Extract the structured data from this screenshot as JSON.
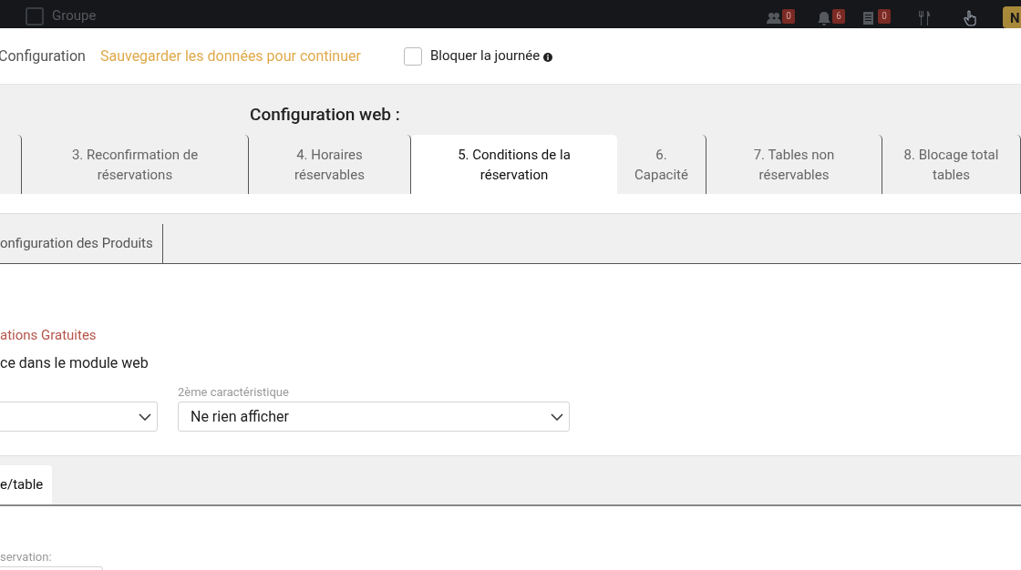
{
  "top_bar": {
    "group_checkbox": {
      "checked": false
    },
    "group_label": "Groupe",
    "badges": [
      {
        "kind": "people",
        "count": "0"
      },
      {
        "kind": "bell",
        "count": "6"
      },
      {
        "kind": "list",
        "count": "0"
      },
      {
        "kind": "cutlery"
      },
      {
        "kind": "hand"
      }
    ],
    "button": "N"
  },
  "header": {
    "title": "Configuration",
    "save_notice": "Sauvegarder les données pour continuer",
    "block_day": {
      "label": "Bloquer la journée",
      "checked": false
    }
  },
  "web_config": {
    "title": "Configuration web :",
    "tabs": [
      {
        "selected": false
      },
      {
        "lines": [
          "3. Reconfirmation de",
          "réservations"
        ],
        "selected": false
      },
      {
        "lines": [
          "4. Horaires",
          "réservables"
        ],
        "selected": false
      },
      {
        "lines": [
          "5. Conditions de la",
          "réservation"
        ],
        "selected": true
      },
      {
        "lines": [
          "6.",
          "Capacité"
        ],
        "selected": false
      },
      {
        "lines": [
          "7. Tables non",
          "réservables"
        ],
        "selected": false
      },
      {
        "lines": [
          "8. Blocage total",
          "tables"
        ],
        "selected": false
      }
    ]
  },
  "sub_tabs": [
    {
      "label": "onfiguration des Produits",
      "selected": false
    }
  ],
  "section": {
    "title": "ations Gratuites",
    "text": "ce dans le module web",
    "selects": [
      {
        "kind": "dropdown"
      },
      {
        "kind": "dropdown",
        "label": "2ème caractéristique",
        "value": "Ne rien afficher"
      }
    ]
  },
  "lower_tabs": [
    {
      "label": "e/table",
      "selected": true
    }
  ],
  "lower_field": {
    "label": "servation:"
  }
}
